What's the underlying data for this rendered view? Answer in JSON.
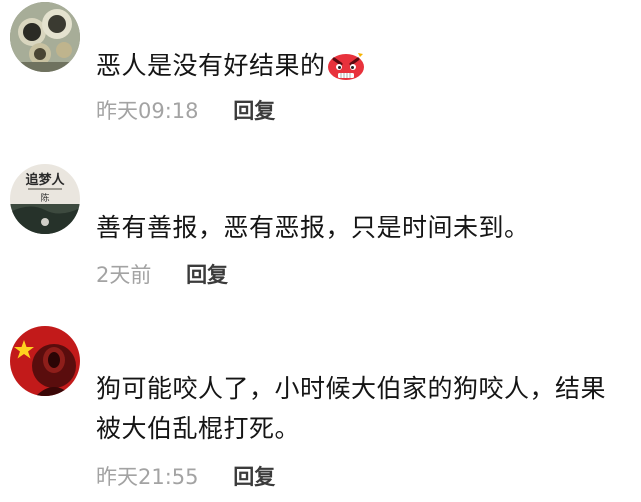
{
  "comments": [
    {
      "text": "恶人是没有好结果的",
      "emoji": "angry-face-icon",
      "time": "昨天09:18",
      "reply_label": "回复"
    },
    {
      "text": "善有善报，恶有恶报，只是时间未到。",
      "avatar_text": "追梦人",
      "avatar_sub": "陈",
      "time": "2天前",
      "reply_label": "回复"
    },
    {
      "text": "狗可能咬人了，小时候大伯家的狗咬人，结果被大伯乱棍打死。",
      "time": "昨天21:55",
      "reply_label": "回复"
    }
  ],
  "colors": {
    "text": "#151515",
    "meta": "#a3a3a3",
    "reply": "#3b3b3b",
    "emoji_red": "#e8323c"
  }
}
